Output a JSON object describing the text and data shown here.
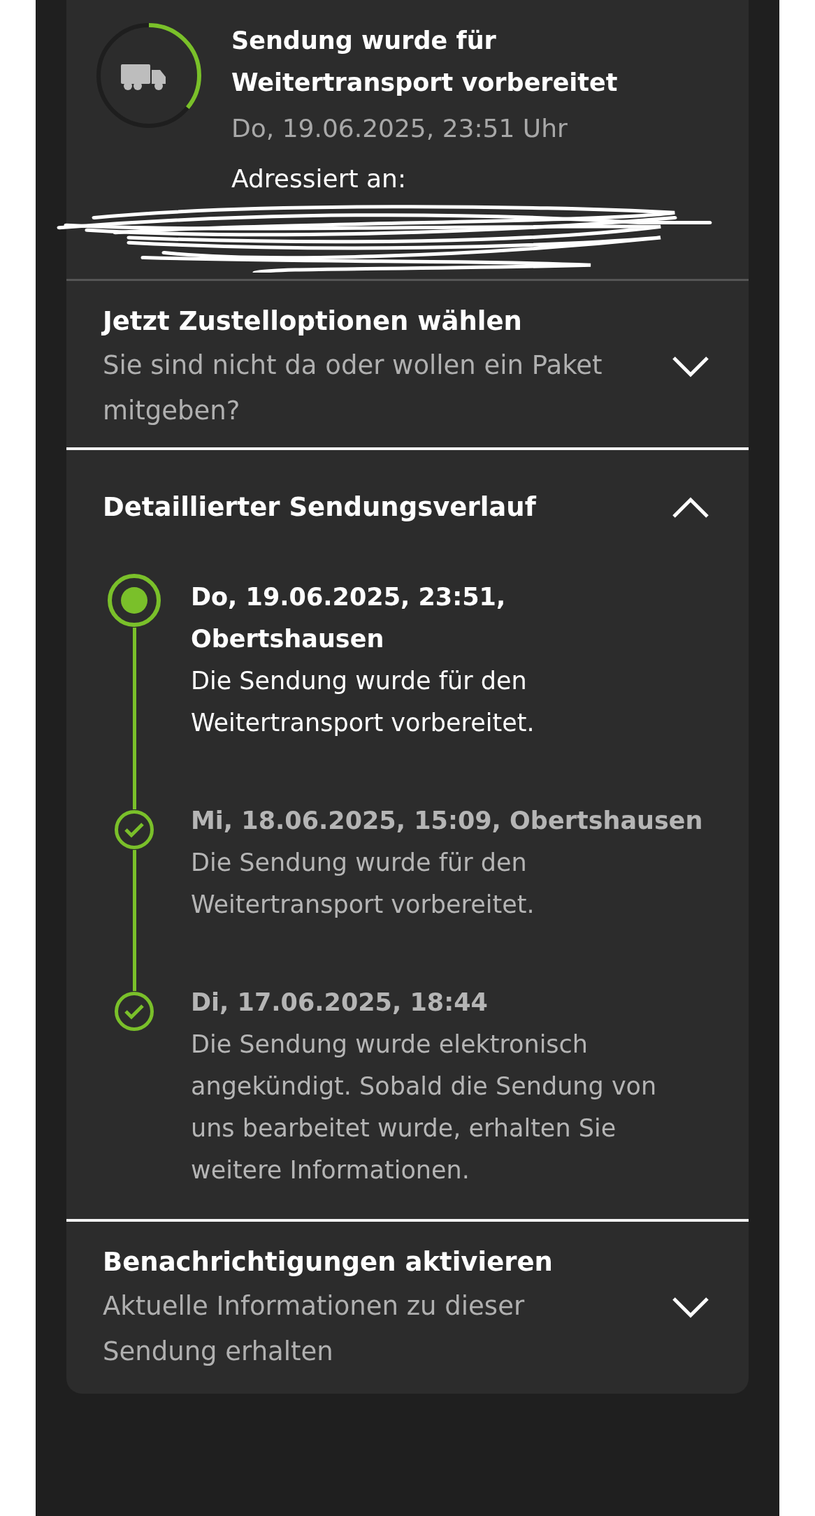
{
  "status": {
    "title": "Sendung wurde für Weitertransport vorbereitet",
    "date": "Do, 19.06.2025, 23:51 Uhr",
    "address_label": "Adressiert an:",
    "level": 0.36
  },
  "sections": [
    {
      "title": "Jetzt Zustelloptionen wählen",
      "subtitle": "Sie sind nicht da oder wollen ein Paket mitgeben?",
      "expanded": false
    },
    {
      "title": "Detaillierter Sendungsverlauf",
      "expanded": true,
      "events": [
        {
          "kind": "current",
          "heading": "Do, 19.06.2025, 23:51, Obertshausen",
          "text": "Die Sendung wurde für den Weitertransport vorbereitet."
        },
        {
          "kind": "done",
          "heading": "Mi, 18.06.2025, 15:09, Obertshausen",
          "text": "Die Sendung wurde für den Weitertransport vorbereitet."
        },
        {
          "kind": "done",
          "heading": "Di, 17.06.2025, 18:44",
          "text": "Die Sendung wurde elektronisch angekündigt. Sobald die Sendung von uns bearbeitet wurde, erhalten Sie weitere Informationen."
        }
      ]
    },
    {
      "title": "Benachrichtigungen aktivieren",
      "subtitle": "Aktuelle Informationen zu dieser Sendung erhalten",
      "expanded": false
    }
  ]
}
